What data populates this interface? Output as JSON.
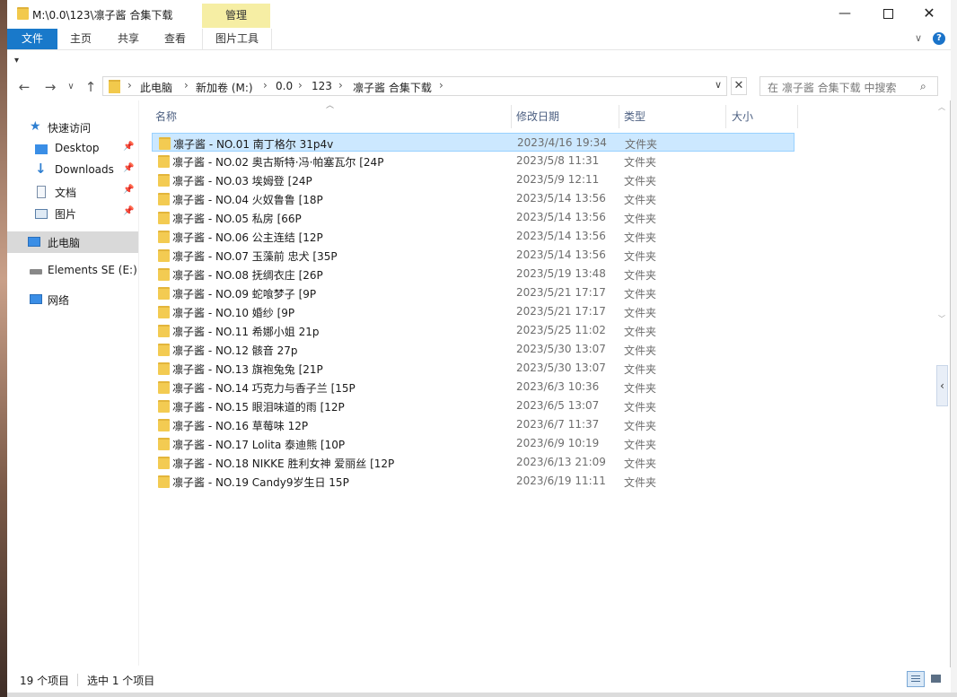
{
  "window": {
    "title": "M:\\0.0\\123\\凛子酱 合集下载",
    "context_tab": "管理",
    "controls": {
      "minimize": "—",
      "close": "✕"
    }
  },
  "ribbon": {
    "tabs": [
      "文件",
      "主页",
      "共享",
      "查看",
      "图片工具"
    ],
    "expand_icon": "chevron-down",
    "help": "?"
  },
  "quick_toolbar": {
    "customize": "▾"
  },
  "nav": {
    "back": "←",
    "forward": "→",
    "history": "∨",
    "up": "↑",
    "breadcrumb": [
      "此电脑",
      "新加卷 (M:)",
      "0.0",
      "123",
      "凛子酱 合集下载"
    ],
    "separator": "›",
    "dropdown": "∨",
    "refresh": "✕",
    "search_placeholder": "在 凛子酱 合集下载 中搜索"
  },
  "sidebar": {
    "items": [
      {
        "label": "快速访问",
        "icon": "star-icon",
        "pinned": false
      },
      {
        "label": "Desktop",
        "icon": "desktop-icon",
        "pinned": true
      },
      {
        "label": "Downloads",
        "icon": "download-icon",
        "pinned": true
      },
      {
        "label": "文档",
        "icon": "document-icon",
        "pinned": true
      },
      {
        "label": "图片",
        "icon": "picture-icon",
        "pinned": true
      },
      {
        "label": "此电脑",
        "icon": "computer-icon",
        "pinned": false,
        "selected": true
      },
      {
        "label": "Elements SE (E:)",
        "icon": "drive-icon",
        "pinned": false
      },
      {
        "label": "网络",
        "icon": "network-icon",
        "pinned": false
      }
    ]
  },
  "columns": [
    "名称",
    "修改日期",
    "类型",
    "大小"
  ],
  "files": [
    {
      "name": "凛子酱 - NO.01 南丁格尔 31p4v",
      "date": "2023/4/16 19:34",
      "type": "文件夹",
      "selected": true
    },
    {
      "name": "凛子酱 - NO.02 奥古斯特·冯·帕塞瓦尔 [24P",
      "date": "2023/5/8 11:31",
      "type": "文件夹"
    },
    {
      "name": "凛子酱 - NO.03 埃姆登 [24P",
      "date": "2023/5/9 12:11",
      "type": "文件夹"
    },
    {
      "name": "凛子酱 - NO.04 火奴鲁鲁 [18P",
      "date": "2023/5/14 13:56",
      "type": "文件夹"
    },
    {
      "name": "凛子酱 - NO.05 私房 [66P",
      "date": "2023/5/14 13:56",
      "type": "文件夹"
    },
    {
      "name": "凛子酱 - NO.06 公主连结 [12P",
      "date": "2023/5/14 13:56",
      "type": "文件夹"
    },
    {
      "name": "凛子酱 - NO.07 玉藻前 忠犬 [35P",
      "date": "2023/5/14 13:56",
      "type": "文件夹"
    },
    {
      "name": "凛子酱 - NO.08 抚绸衣庄 [26P",
      "date": "2023/5/19 13:48",
      "type": "文件夹"
    },
    {
      "name": "凛子酱 - NO.09 蛇喰梦子 [9P",
      "date": "2023/5/21 17:17",
      "type": "文件夹"
    },
    {
      "name": "凛子酱 - NO.10 婚纱 [9P",
      "date": "2023/5/21 17:17",
      "type": "文件夹"
    },
    {
      "name": "凛子酱 - NO.11 希娜小姐 21p",
      "date": "2023/5/25 11:02",
      "type": "文件夹"
    },
    {
      "name": "凛子酱 - NO.12 骸音 27p",
      "date": "2023/5/30 13:07",
      "type": "文件夹"
    },
    {
      "name": "凛子酱 - NO.13 旗袍兔兔 [21P",
      "date": "2023/5/30 13:07",
      "type": "文件夹"
    },
    {
      "name": "凛子酱 - NO.14 巧克力与香子兰 [15P",
      "date": "2023/6/3 10:36",
      "type": "文件夹"
    },
    {
      "name": "凛子酱 - NO.15 眼泪味道的雨 [12P",
      "date": "2023/6/5 13:07",
      "type": "文件夹"
    },
    {
      "name": "凛子酱 - NO.16 草莓味 12P",
      "date": "2023/6/7 11:37",
      "type": "文件夹"
    },
    {
      "name": "凛子酱 - NO.17 Lolita 泰迪熊 [10P",
      "date": "2023/6/9 10:19",
      "type": "文件夹"
    },
    {
      "name": "凛子酱 - NO.18 NIKKE 胜利女神 爱丽丝 [12P",
      "date": "2023/6/13 21:09",
      "type": "文件夹"
    },
    {
      "name": "凛子酱 - NO.19 Candy9岁生日 15P",
      "date": "2023/6/19 11:11",
      "type": "文件夹"
    }
  ],
  "status": {
    "count": "19 个项目",
    "selection": "选中 1 个项目"
  },
  "colors": {
    "file_tab": "#1979ca",
    "manage_tab": "#f6eea4",
    "selection": "#cce8ff",
    "folder": "#f3cb52"
  }
}
